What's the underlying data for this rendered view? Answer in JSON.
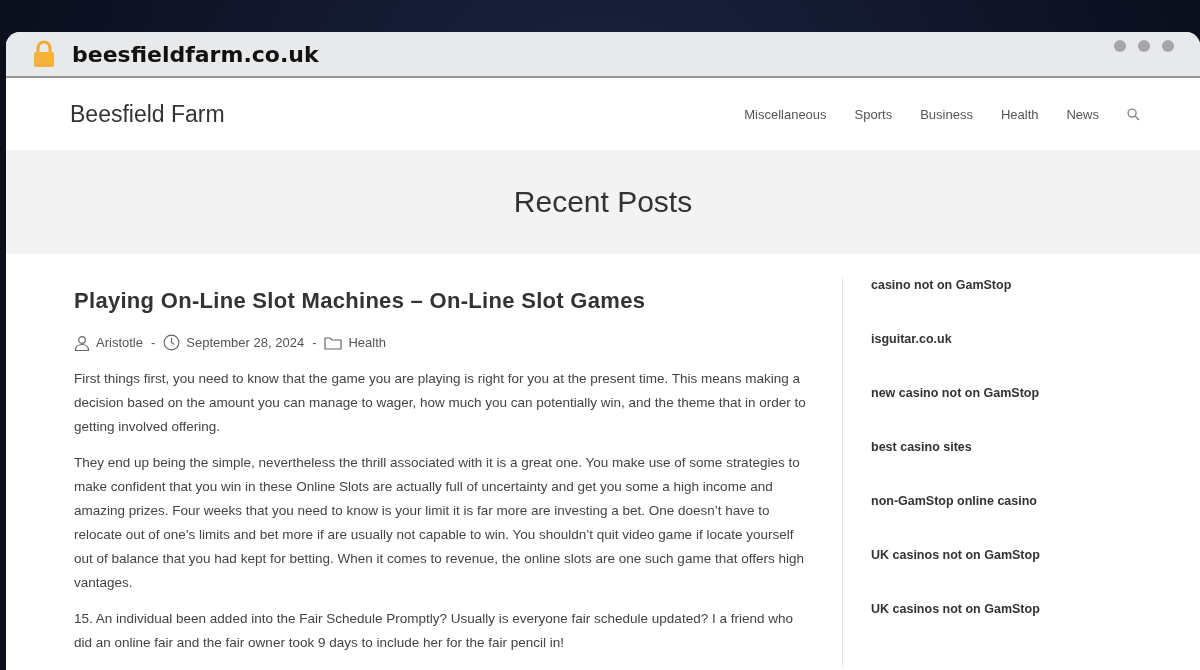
{
  "browser": {
    "url": "beesfieldfarm.co.uk"
  },
  "header": {
    "site_title": "Beesfield Farm",
    "nav": [
      "Miscellaneous",
      "Sports",
      "Business",
      "Health",
      "News"
    ]
  },
  "hero": {
    "title": "Recent Posts"
  },
  "post": {
    "title": "Playing On-Line Slot Machines – On-Line Slot Games",
    "author": "Aristotle",
    "date": "September 28, 2024",
    "category": "Health",
    "meta_separators": [
      "-",
      "-"
    ],
    "paragraphs": [
      "First things first, you need to know that the game you are playing is right for you at the present time. This means making a decision based on the amount you can manage to wager, how much you can potentially win, and the theme that in order to getting involved offering.",
      "They end up being the simple, nevertheless the thrill associated with it is a great one. You make use of some strategies to make confident that you win in these Online Slots are actually full of uncertainty and get you some a high income and amazing prizes. Four weeks that you need to know is your limit it is far more are investing a bet. One doesn’t have to relocate out of one’s limits and bet more if are usually not capable to win. You shouldn’t quit video game if locate yourself out of balance that you had kept for betting. When it comes to revenue, the online slots are one such game that offers high vantages.",
      "15. An individual been added into the Fair Schedule Promptly? Usually is everyone fair schedule updated? I a friend who did an online fair and the fair owner took 9 days to include her for the fair pencil in!"
    ]
  },
  "sidebar": {
    "links": [
      "casino not on GamStop",
      "isguitar.co.uk",
      "new casino not on GamStop",
      "best casino sites",
      "non-GamStop online casino",
      "UK casinos not on GamStop",
      "UK casinos not on GamStop"
    ]
  }
}
